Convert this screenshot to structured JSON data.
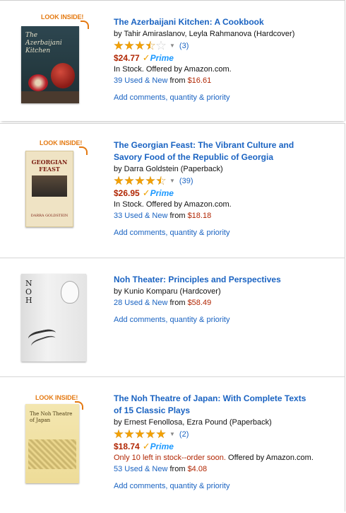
{
  "items": [
    {
      "look_inside": "LOOK INSIDE!",
      "cover_title": "The Azerbaijani Kitchen",
      "title": "The Azerbaijani Kitchen: A Cookbook",
      "byline": "by Tahir Amiraslanov, Leyla Rahmanova (Hardcover)",
      "rating": 3.5,
      "review_count": "(3)",
      "price": "$24.77",
      "prime": "Prime",
      "stock": "In Stock.",
      "offered_by": "Offered by Amazon.com.",
      "used_new": "39 Used & New",
      "from": "from",
      "used_price": "$16.61",
      "add_link": "Add comments, quantity & priority"
    },
    {
      "look_inside": "LOOK INSIDE!",
      "cover_title": "GEORGIAN FEAST",
      "cover_author": "DARRA GOLDSTEIN",
      "title_line1": "The Georgian Feast: The Vibrant Culture and",
      "title_line2": "Savory Food of the Republic of Georgia",
      "byline": "by Darra Goldstein (Paperback)",
      "rating": 4.5,
      "review_count": "(39)",
      "price": "$26.95",
      "prime": "Prime",
      "stock": "In Stock.",
      "offered_by": "Offered by Amazon.com.",
      "used_new": "33 Used & New",
      "from": "from",
      "used_price": "$18.18",
      "add_link": "Add comments, quantity & priority"
    },
    {
      "cover_title": "NOH",
      "title": "Noh Theater: Principles and Perspectives",
      "byline": "by Kunio Komparu (Hardcover)",
      "used_new": "28 Used & New",
      "from": "from",
      "used_price": "$58.49",
      "add_link": "Add comments, quantity & priority"
    },
    {
      "look_inside": "LOOK INSIDE!",
      "cover_title": "The Noh Theatre of Japan",
      "title_line1": "The Noh Theatre of Japan: With Complete Texts",
      "title_line2": "of 15 Classic Plays",
      "byline": "by Ernest Fenollosa, Ezra Pound (Paperback)",
      "rating": 5,
      "review_count": "(2)",
      "price": "$18.74",
      "prime": "Prime",
      "stock_low": "Only 10 left in stock--order soon.",
      "offered_by": "Offered by Amazon.com.",
      "used_new": "53 Used & New",
      "from": "from",
      "used_price": "$4.08",
      "add_link": "Add comments, quantity & priority"
    }
  ],
  "colors": {
    "link": "#1a63c2",
    "price": "#b12704",
    "star": "#f4a000",
    "prime": "#1a98ff",
    "look_inside": "#e47911"
  }
}
